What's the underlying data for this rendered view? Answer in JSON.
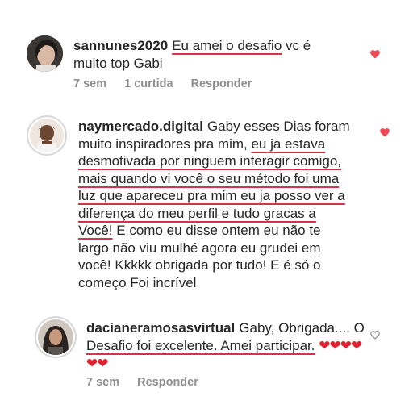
{
  "comments": [
    {
      "username": "sannunes2020",
      "text_pre": "",
      "text_underlined": "Eu amei o desafio",
      "text_post": " vc é muito top Gabi",
      "time": "7 sem",
      "likes": "1 curtida",
      "reply": "Responder",
      "liked": true,
      "heart_color": "#ed4956"
    },
    {
      "username": "naymercado.digital",
      "text_pre": "Gaby esses Dias foram muito inspiradores pra mim, ",
      "text_underlined": "eu ja estava desmotivada por ninguem interagir comigo, mais quando vi você o seu método foi uma luz que apareceu pra mim eu ja posso ver a diferença do meu perfil e tudo gracas a Você!",
      "text_post": " E como eu disse ontem eu não te largo não viu mulhé agora eu grudei em você!  Kkkkk obrigada por tudo! E é só o começo Foi incrível",
      "liked": true,
      "heart_color": "#ed4956"
    },
    {
      "username": "dacianeramosasvirtual",
      "text_pre": "Gaby, Obrigada.... O ",
      "text_underlined": "Desafio foi excelente. Amei participar.",
      "text_post": "",
      "emoji_hearts": "❤❤❤❤❤❤",
      "time": "7 sem",
      "reply": "Responder",
      "liked": false
    }
  ],
  "colors": {
    "underline": "#d6334a",
    "heart": "#ed4956",
    "meta": "#8e8e8e"
  }
}
